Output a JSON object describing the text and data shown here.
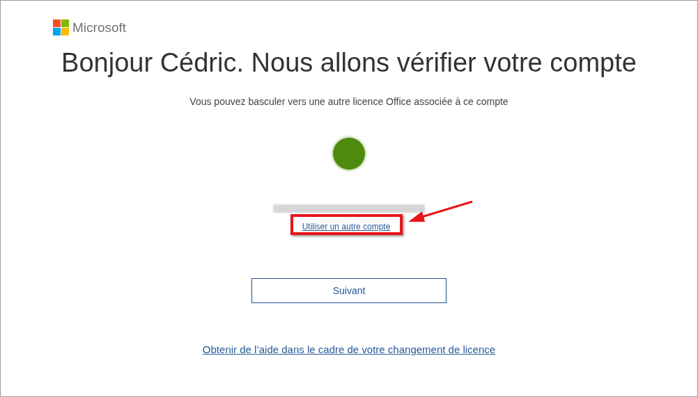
{
  "brand": {
    "name": "Microsoft"
  },
  "title": "Bonjour Cédric. Nous allons vérifier votre compte",
  "subtitle": "Vous pouvez basculer vers une autre licence Office associée à ce compte",
  "account": {
    "switch_link": "Utiliser un autre compte"
  },
  "buttons": [
    {
      "label": "Suivant"
    }
  ],
  "help_link": "Obtenir de l’aide dans le cadre de votre changement de licence"
}
